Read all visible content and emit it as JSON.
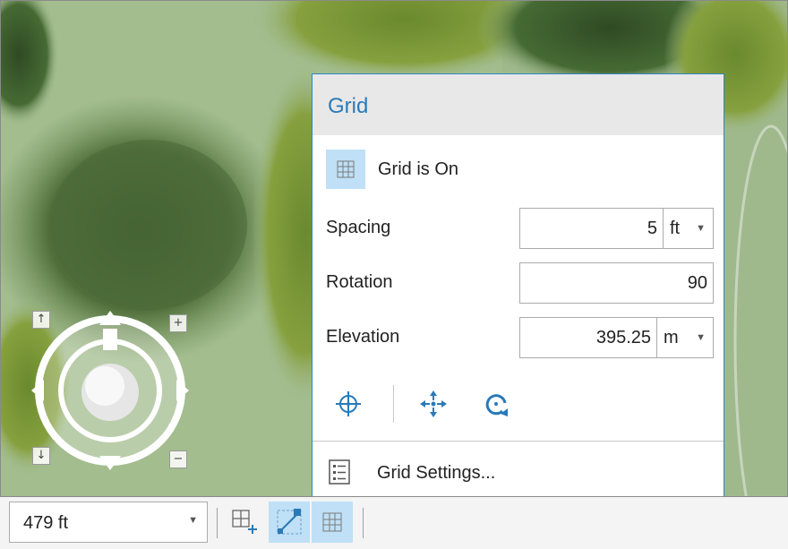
{
  "panel": {
    "title": "Grid",
    "toggle_label": "Grid is On",
    "spacing": {
      "label": "Spacing",
      "value": "5",
      "unit": "ft"
    },
    "rotation": {
      "label": "Rotation",
      "value": "90"
    },
    "elevation": {
      "label": "Elevation",
      "value": "395.25",
      "unit": "m"
    },
    "tools": [
      "crosshair-icon",
      "move-icon",
      "rotate-icon"
    ],
    "settings_label": "Grid Settings..."
  },
  "status_bar": {
    "scale_value": "479 ft",
    "buttons": [
      "grid-add-icon",
      "snap-grid-icon",
      "grid-toggle-icon"
    ]
  },
  "navigator": {
    "buttons": [
      "up-arrow",
      "down-arrow",
      "plus",
      "minus"
    ]
  },
  "colors": {
    "accent": "#2a7ab8",
    "panel_border": "#2f86c3",
    "active_button": "#bfe0f6",
    "terrain": "#9fb98a"
  }
}
